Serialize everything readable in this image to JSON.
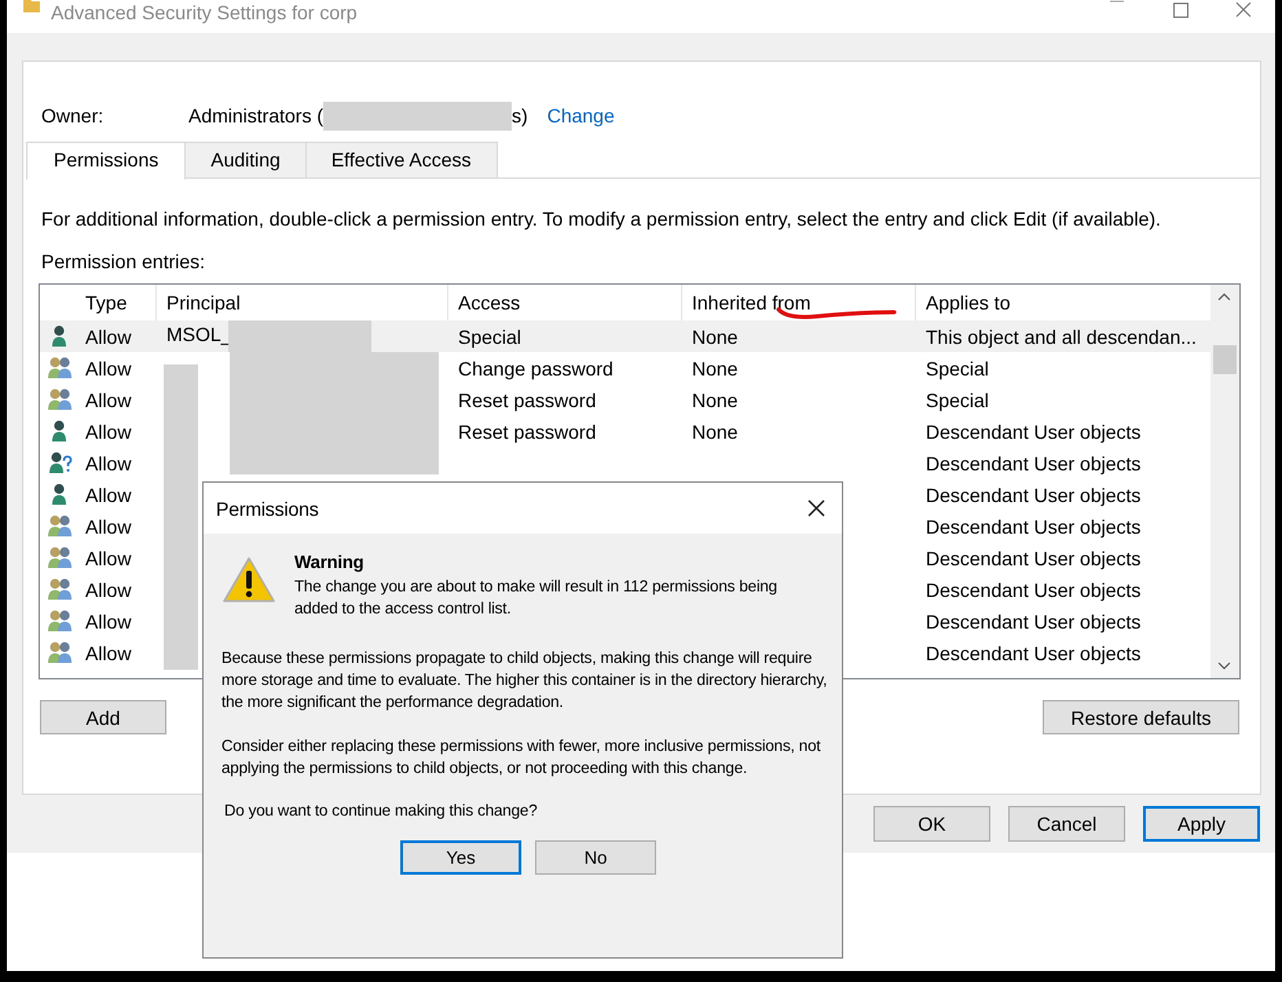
{
  "window": {
    "title": "Advanced Security Settings for corp"
  },
  "owner": {
    "label": "Owner:",
    "value_start": "Administrators (",
    "value_end": "s)",
    "link": "Change"
  },
  "tabs": [
    {
      "label": "Permissions",
      "selected": true
    },
    {
      "label": "Auditing",
      "selected": false
    },
    {
      "label": "Effective Access",
      "selected": false
    }
  ],
  "description": "For additional information, double-click a permission entry. To modify a permission entry, select the entry and click Edit (if available).",
  "entries_label": "Permission entries:",
  "table": {
    "columns": [
      "Type",
      "Principal",
      "Access",
      "Inherited from",
      "Applies to"
    ],
    "rows": [
      {
        "kind": "user",
        "type": "Allow",
        "principal": "MSOL_",
        "access": "Special",
        "inherited": "None",
        "applies": "This object and all descendan...",
        "selected": true
      },
      {
        "kind": "group",
        "type": "Allow",
        "access": "Change password",
        "inherited": "None",
        "applies": "Special",
        "selected": false
      },
      {
        "kind": "group",
        "type": "Allow",
        "access": "Reset password",
        "inherited": "None",
        "applies": "Special",
        "selected": false
      },
      {
        "kind": "user",
        "type": "Allow",
        "access": "Reset password",
        "inherited": "None",
        "applies": "Descendant User objects",
        "selected": false
      },
      {
        "kind": "unknown",
        "type": "Allow",
        "applies": "Descendant User objects",
        "selected": false
      },
      {
        "kind": "user",
        "type": "Allow",
        "applies": "Descendant User objects",
        "selected": false
      },
      {
        "kind": "group",
        "type": "Allow",
        "applies": "Descendant User objects",
        "selected": false
      },
      {
        "kind": "group",
        "type": "Allow",
        "applies": "Descendant User objects",
        "selected": false
      },
      {
        "kind": "group",
        "type": "Allow",
        "applies": "Descendant User objects",
        "selected": false
      },
      {
        "kind": "group",
        "type": "Allow",
        "applies": "Descendant User objects",
        "selected": false
      },
      {
        "kind": "group",
        "type": "Allow",
        "applies": "Descendant User objects",
        "selected": false
      }
    ]
  },
  "list_buttons": [
    "Add",
    "Restore defaults"
  ],
  "footer_buttons": [
    {
      "label": "OK",
      "focused": false
    },
    {
      "label": "Cancel",
      "focused": false
    },
    {
      "label": "Apply",
      "focused": true
    }
  ],
  "dialog": {
    "title": "Permissions",
    "heading": "Warning",
    "message": "The change you are about to make will result in 112 permissions being added to the access control list.",
    "details": [
      "Because these permissions propagate to child objects, making this change will require more storage and time to evaluate. The higher this container is in the directory hierarchy, the more significant the performance degradation.",
      "Consider either replacing these permissions with fewer, more inclusive permissions, not applying the permissions to child objects, or not proceeding with this change."
    ],
    "question": "Do you want to continue making this change?",
    "buttons": [
      {
        "label": "Yes",
        "focused": true
      },
      {
        "label": "No",
        "focused": false
      }
    ]
  }
}
